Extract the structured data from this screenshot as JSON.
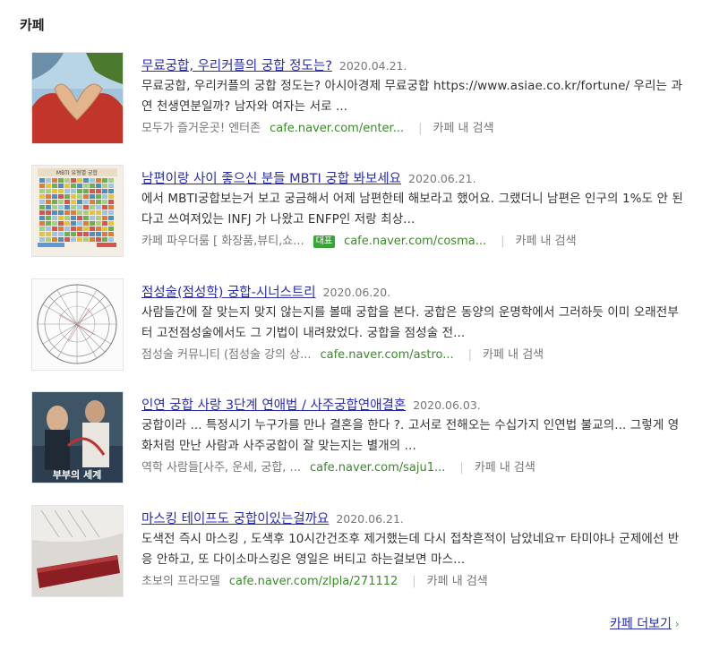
{
  "section": {
    "title": "카페"
  },
  "items": [
    {
      "title": "무료궁합, 우리커플의 궁합 정도는?",
      "date": "2020.04.21.",
      "desc": "무료궁합, 우리커플의 궁합 정도는? 아시아경제 무료궁합 https://www.asiae.co.kr/fortune/ 우리는 과연 천생연분일까? 남자와 여자는 서로 ...",
      "cafe": "모두가 즐거운곳! 엔터존",
      "url": "cafe.naver.com/enter...",
      "search_in": "카페 내 검색"
    },
    {
      "title": "남편이랑 사이 좋으신 분들 MBTI 궁합 봐보세요",
      "date": "2020.06.21.",
      "desc": "에서 MBTI궁합보는거 보고 궁금해서 어제 남편한테 해보라고 했어요. 그랬더니 남편은 인구의 1%도 안 된다고 쓰여져있는 INFJ 가 나왔고 ENFP인 저랑 최상...",
      "cafe": "카페 파우더룸 [ 화장품,뷰티,쇼...",
      "badge": "대표",
      "url": "cafe.naver.com/cosma...",
      "search_in": "카페 내 검색",
      "thumb_title": "MBTI 유형별 궁합"
    },
    {
      "title": "점성술(점성학) 궁합-시너스트리",
      "date": "2020.06.20.",
      "desc": "사람들간에 잘 맞는지 맞지 않는지를 볼때 궁합을 본다. 궁합은 동양의 운명학에서 그러하듯 이미 오래전부터 고전점성술에서도 그 기법이 내려왔었다. 궁합을 점성술 전...",
      "cafe": "점성술 커뮤니티 (점성술 강의 상...",
      "url": "cafe.naver.com/astro...",
      "search_in": "카페 내 검색"
    },
    {
      "title": "인연 궁합 사랑 3단계 연애법 / 사주궁합연애결혼",
      "date": "2020.06.03.",
      "desc": "궁합이라 ... 특정시기 누구가를 만나 결혼을 한다 ?. 고서로 전해오는 수십가지 인연법 불교의... 그렇게 영화처럼 만난 사람과 사주궁합이 잘 맞는지는 별개의 ...",
      "cafe": "역학 사람들[사주, 운세, 궁합, ...",
      "url": "cafe.naver.com/saju1...",
      "search_in": "카페 내 검색",
      "thumb_title": "부부의 세계"
    },
    {
      "title": "마스킹 테이프도 궁합이있는걸까요",
      "date": "2020.06.21.",
      "desc": "도색전 즉시 마스킹 , 도색후 10시간건조후 제거했는데 다시 접착흔적이 남았네요ㅠ 타미야나 군제에선 반응 안하고, 또 다이소마스킹은 영일은 버티고 하는걸보면 마스...",
      "cafe": "초보의 프라모델",
      "url": "cafe.naver.com/zlpla/271112",
      "search_in": "카페 내 검색"
    }
  ],
  "more": {
    "label": "카페 더보기"
  },
  "colors": {
    "link": "#2a2cb0",
    "url": "#3b8a2a",
    "badge": "#37a637"
  }
}
